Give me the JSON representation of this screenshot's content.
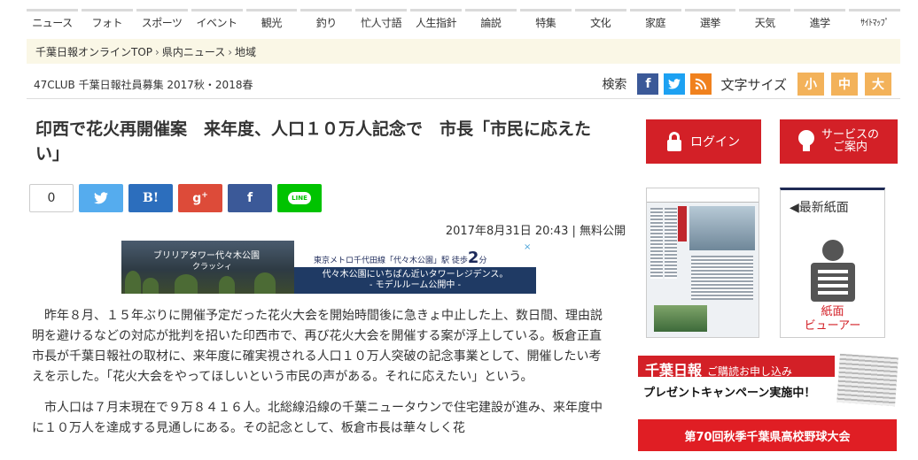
{
  "nav": [
    "ニュース",
    "フォト",
    "スポーツ",
    "イベント",
    "観光",
    "釣り",
    "忙人寸語",
    "人生指針",
    "論説",
    "特集",
    "文化",
    "家庭",
    "選挙",
    "天気",
    "進学",
    "ｻｲﾄﾏｯﾌﾟ"
  ],
  "breadcrumb": [
    "千葉日報オンラインTOP",
    "県内ニュース",
    "地域"
  ],
  "breadcrumb_sep": "›",
  "subbar": {
    "club": "47CLUB 千葉日報社員募集 2017秋・2018春",
    "search": "検索",
    "font_size_label": "文字サイズ",
    "font_sizes": [
      "小",
      "中",
      "大"
    ]
  },
  "social_icons": {
    "facebook": "f",
    "twitter": "t",
    "rss": "rss"
  },
  "article": {
    "title": "印西で花火再開催案　来年度、人口１０万人記念で　市長「市民に応えたい」",
    "share_count": "0",
    "share_buttons": {
      "twitter": "t",
      "hatena": "B!",
      "gplus": "8+",
      "facebook": "f",
      "line": "LINE"
    },
    "date": "2017年8月31日 20:43 | 無料公開",
    "paragraphs": [
      "昨年８月、１５年ぶりに開催予定だった花火大会を開始時間後に急きょ中止した上、数日間、理由説明を避けるなどの対応が批判を招いた印西市で、再び花火大会を開催する案が浮上している。板倉正直市長が千葉日報社の取材に、来年度に確実視される人口１０万人突破の記念事業として、開催したい考えを示した。「花火大会をやってほしいという市民の声がある。それに応えたい」という。",
      "市人口は７月末現在で９万８４１６人。北総線沿線の千葉ニュータウンで住宅建設が進み、来年度中に１０万人を達成する見通しにある。その記念として、板倉市長は華々しく花"
    ]
  },
  "ad": {
    "left_title": "ブリリアタワー代々木公園",
    "left_sub": "クラッシィ",
    "right_line": "東京メトロ千代田線「代々木公園」駅",
    "walk": "徒歩",
    "minutes": "2",
    "minutes_unit": "分",
    "bottom1": "代々木公園にいちばん近いタワーレジデンス。",
    "bottom2": "- モデルルーム公開中 -",
    "close": "×"
  },
  "sidebar": {
    "login": "ログイン",
    "service": "サービスの\nご案内",
    "latest_label": "◀最新紙面",
    "viewer_caption": "紙面\nビューアー",
    "promo_brand": "千葉日報",
    "promo_band": "ご購読お申し込み",
    "promo_sub": "プレゼントキャンペーン実施中！",
    "baseball": "第70回秋季千葉県高校野球大会"
  }
}
